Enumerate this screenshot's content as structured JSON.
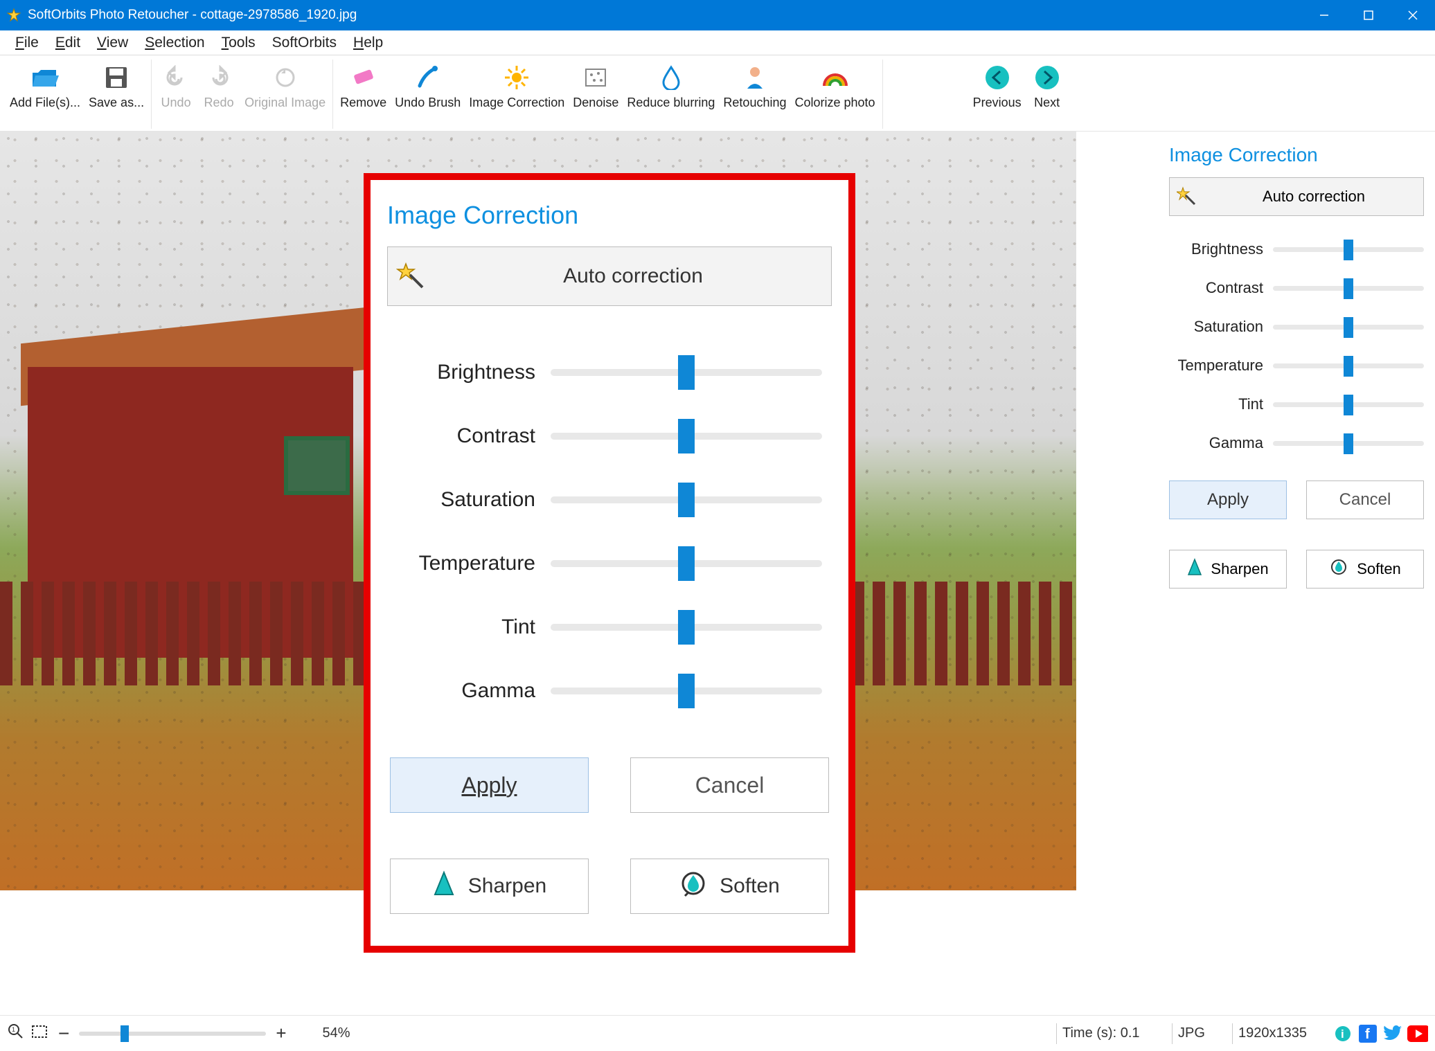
{
  "title": "SoftOrbits Photo Retoucher - cottage-2978586_1920.jpg",
  "menu": {
    "file": "File",
    "edit": "Edit",
    "view": "View",
    "selection": "Selection",
    "tools": "Tools",
    "softorbits": "SoftOrbits",
    "help": "Help"
  },
  "toolbar": {
    "add_files": "Add File(s)...",
    "save_as": "Save as...",
    "undo": "Undo",
    "redo": "Redo",
    "original": "Original Image",
    "remove": "Remove",
    "undo_brush": "Undo Brush",
    "image_correction": "Image Correction",
    "denoise": "Denoise",
    "reduce_blurring": "Reduce blurring",
    "retouching": "Retouching",
    "colorize": "Colorize photo",
    "previous": "Previous",
    "next": "Next"
  },
  "correction": {
    "title": "Image Correction",
    "auto": "Auto correction",
    "sliders": [
      "Brightness",
      "Contrast",
      "Saturation",
      "Temperature",
      "Tint",
      "Gamma"
    ],
    "apply": "Apply",
    "cancel": "Cancel",
    "sharpen": "Sharpen",
    "soften": "Soften"
  },
  "status": {
    "zoom": "54%",
    "time": "Time (s): 0.1",
    "format": "JPG",
    "dims": "1920x1335"
  }
}
